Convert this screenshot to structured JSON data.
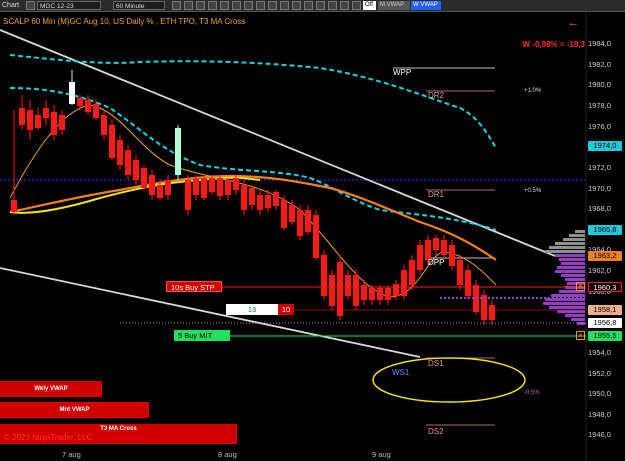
{
  "toolbar": {
    "app_label": "Chart",
    "instrument": "MGC 12-23",
    "interval": "60 Minute",
    "toggle_off": "Off",
    "toggle_m_vwap": "M VWAP",
    "toggle_w_vwap": "W VWAP"
  },
  "chart": {
    "title": "SCALP 60 Min (M)GC Aug 10, US Daily % , ETH TPO, T3 MA Cross",
    "change_label": "W -0,98% = -19,3",
    "copyright": "© 2023 NinjaTrader, LLC",
    "price_ticks": [
      "1984,0",
      "1982,0",
      "1980,0",
      "1978,0",
      "1976,0",
      "1972,0",
      "1970,0",
      "1968,0",
      "1966,0",
      "1964,0",
      "1962,0",
      "1960,0",
      "1958,0",
      "1954,0",
      "1952,0",
      "1950,0",
      "1948,0",
      "1946,0"
    ],
    "price_badges": {
      "vwap_upper": "1974,0",
      "upper_band": "1965,8",
      "ma_orange": "1963,2",
      "stop_price": "1960,3",
      "current": "1958,1",
      "last_low": "1956,8",
      "mit_price": "1955,5"
    },
    "dates": [
      "7 aug",
      "8 aug",
      "9 aug"
    ],
    "levels": {
      "wpp": "WPP",
      "dr2": "DR2",
      "dr1": "DR1",
      "dpp": "DPP",
      "ds1": "DS1",
      "ws1": "WS1",
      "ds2": "DS2"
    },
    "pct_labels": {
      "p1": "+1.0%",
      "p05": "+0.5%",
      "m05": "-0.5%"
    },
    "orders": {
      "stop_label": "10s  Buy STP",
      "position_qty": "13",
      "position_count": "10",
      "mit_label": "5  Buy MIT"
    },
    "vwap_bars": {
      "weekly": "Wkly VWAP",
      "monthly": "Mnt VWAP",
      "t3": "T3 MA Cross"
    },
    "colors": {
      "up_candle": "#b0ffd8",
      "down_candle": "#ff1a1a",
      "vwap_dots": "#20d0d8",
      "ma_orange": "#f08020",
      "ma_yellow": "#f0e020",
      "stop_red": "#ff2020",
      "mit_green": "#20e060",
      "tpo_gray": "#909090",
      "tpo_purple": "#9040c0"
    }
  }
}
